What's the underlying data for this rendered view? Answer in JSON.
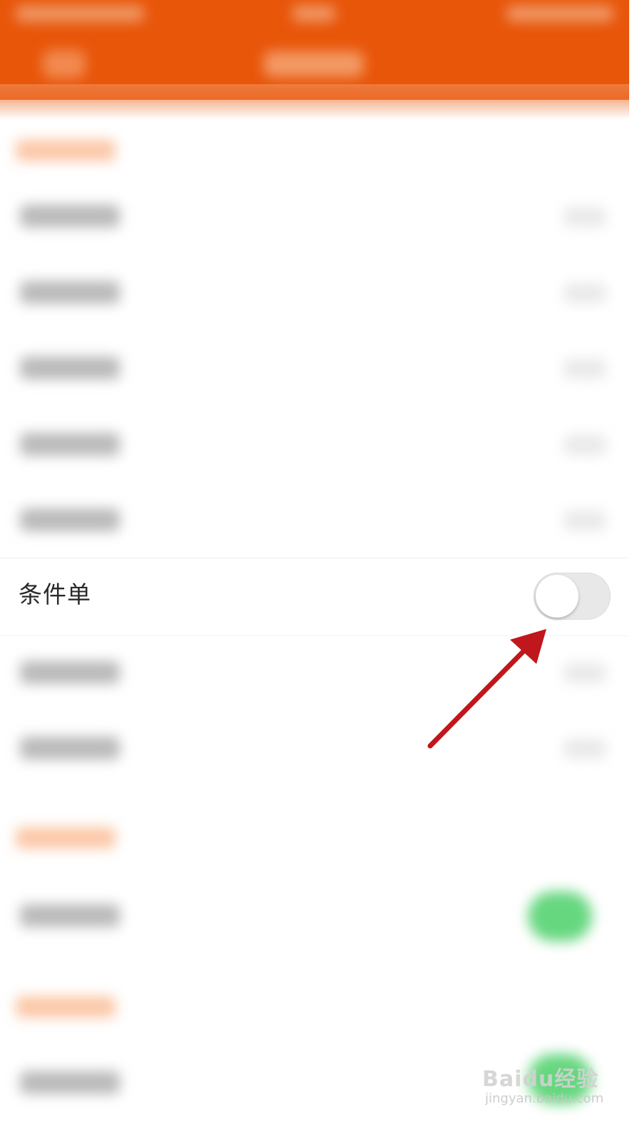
{
  "settings": {
    "condition_order": {
      "label": "条件单",
      "toggle_on": false
    }
  },
  "watermark": {
    "brand": "Baidu经验",
    "url": "jingyan.baidu.com"
  },
  "colors": {
    "header": "#e8560a",
    "annotation_arrow": "#c0171c",
    "toggle_on": "#66d77f"
  },
  "icons": [
    "back-icon",
    "toggle-switch",
    "annotation-arrow-icon",
    "baidu-paw-icon"
  ]
}
